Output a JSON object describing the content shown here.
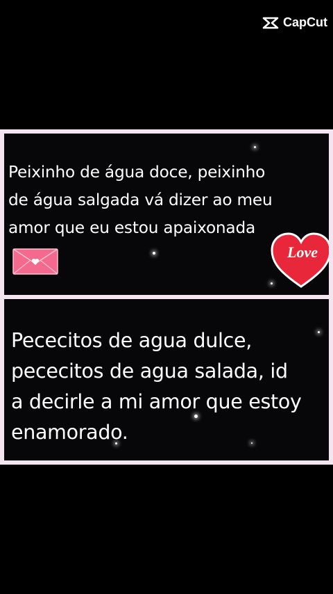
{
  "watermark": {
    "text": "CapCut",
    "icon": "capcut-logo-icon"
  },
  "panel_portuguese": {
    "lines": [
      "Peixinho de água doce, peixinho",
      "de água salgada vá dizer ao meu",
      "amor que eu estou apaixonada"
    ],
    "sticker_text": "Love"
  },
  "panel_spanish": {
    "lines": [
      "Pececitos de agua dulce,",
      "pececitos de agua salada, id",
      "a decirle a mi amor que estoy",
      "enamorado."
    ]
  },
  "colors": {
    "frame": "#f4e6f1",
    "heart_red": "#e8283a",
    "envelope_pink": "#f36a8e",
    "wave_blue": "#5a73ff",
    "wave_pink": "#d25cff"
  }
}
